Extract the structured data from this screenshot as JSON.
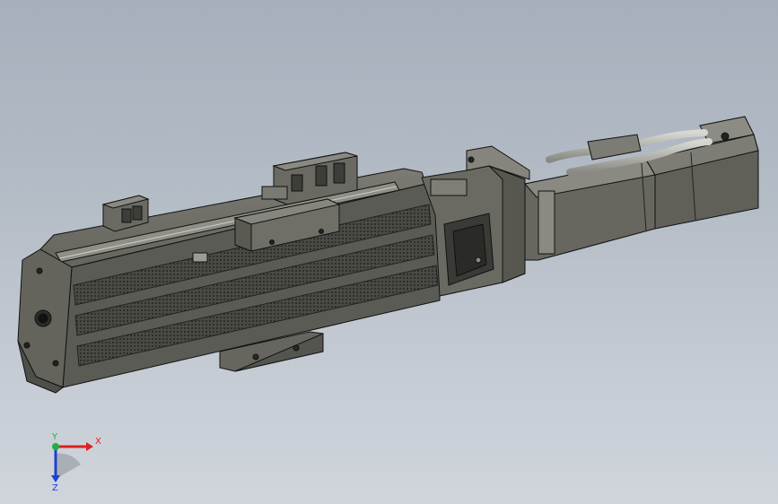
{
  "viewport": {
    "background_top": "#a6b0bc",
    "background_bottom": "#d0d5dc",
    "model_color": "#5c5c56",
    "outline_color": "#111111"
  },
  "triad": {
    "x_label": "X",
    "y_label": "Y",
    "z_label": "Z",
    "x_color": "#e02020",
    "y_color": "#20b040",
    "z_color": "#2040d0"
  }
}
